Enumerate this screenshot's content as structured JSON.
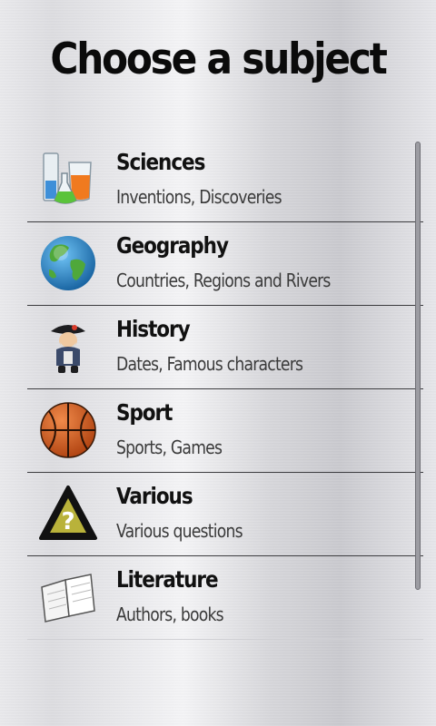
{
  "header": {
    "title": "Choose a subject"
  },
  "subjects": [
    {
      "title": "Sciences",
      "subtitle": "Inventions, Discoveries",
      "icon": "lab-flasks-icon"
    },
    {
      "title": "Geography",
      "subtitle": "Countries, Regions and Rivers",
      "icon": "globe-icon"
    },
    {
      "title": "History",
      "subtitle": "Dates, Famous characters",
      "icon": "napoleon-character-icon"
    },
    {
      "title": "Sport",
      "subtitle": "Sports, Games",
      "icon": "basketball-icon"
    },
    {
      "title": "Various",
      "subtitle": "Various questions",
      "icon": "question-triangle-icon"
    },
    {
      "title": "Literature",
      "subtitle": "Authors, books",
      "icon": "open-book-icon"
    }
  ],
  "colors": {
    "title_text": "#0b0b0b",
    "divider": "#3c3c3f",
    "scrollbar": "#9c9ca2"
  }
}
